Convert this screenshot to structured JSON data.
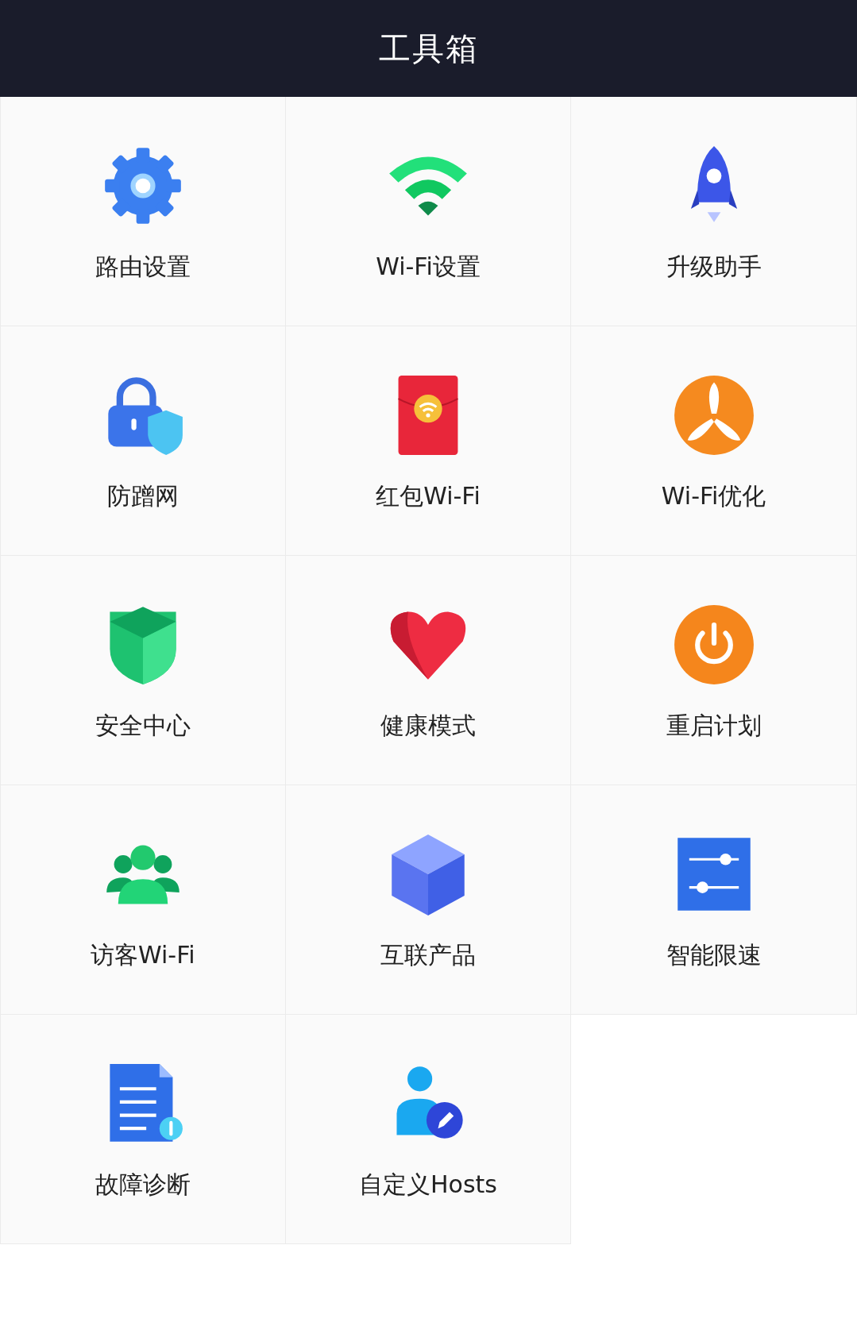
{
  "header": {
    "title": "工具箱"
  },
  "tools": [
    {
      "label": "路由设置",
      "kind": "gear"
    },
    {
      "label": "Wi-Fi设置",
      "kind": "wifi"
    },
    {
      "label": "升级助手",
      "kind": "rocket"
    },
    {
      "label": "防蹭网",
      "kind": "lock"
    },
    {
      "label": "红包Wi-Fi",
      "kind": "envelope"
    },
    {
      "label": "Wi-Fi优化",
      "kind": "fan"
    },
    {
      "label": "安全中心",
      "kind": "shield"
    },
    {
      "label": "健康模式",
      "kind": "heart"
    },
    {
      "label": "重启计划",
      "kind": "power"
    },
    {
      "label": "访客Wi-Fi",
      "kind": "people"
    },
    {
      "label": "互联产品",
      "kind": "cube"
    },
    {
      "label": "智能限速",
      "kind": "sliders"
    },
    {
      "label": "故障诊断",
      "kind": "document"
    },
    {
      "label": "自定义Hosts",
      "kind": "person"
    }
  ]
}
